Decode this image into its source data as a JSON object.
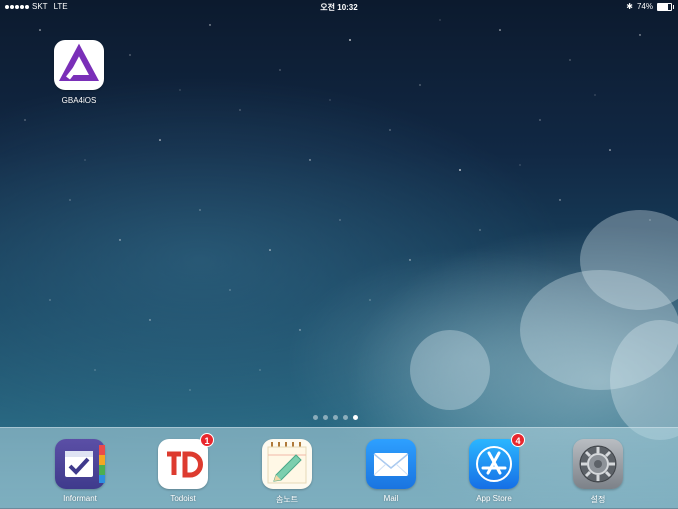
{
  "status_bar": {
    "carrier": "SKT",
    "network": "LTE",
    "time": "오전 10:32",
    "battery_percent": "74%",
    "battery_level": 0.74,
    "signal_dots": 5
  },
  "home_apps": [
    {
      "label": "GBA4iOS",
      "icon": "gba4ios-icon"
    }
  ],
  "page_indicator": {
    "count": 5,
    "current": 4
  },
  "dock": [
    {
      "label": "Informant",
      "icon": "calendar-check-icon"
    },
    {
      "label": "Todoist",
      "icon": "todoist-icon",
      "badge": "1"
    },
    {
      "label": "솜노트",
      "icon": "notepad-pencil-icon"
    },
    {
      "label": "Mail",
      "icon": "envelope-icon"
    },
    {
      "label": "App Store",
      "icon": "app-store-icon",
      "badge": "4"
    },
    {
      "label": "설정",
      "icon": "gear-icon"
    }
  ],
  "colors": {
    "badge": "#e8262d",
    "gba_purple": "#7a2fb8",
    "todoist_red": "#dd3b2f",
    "mail_blue": "#1f8ff0",
    "appstore_blue": "#1b9af5"
  }
}
